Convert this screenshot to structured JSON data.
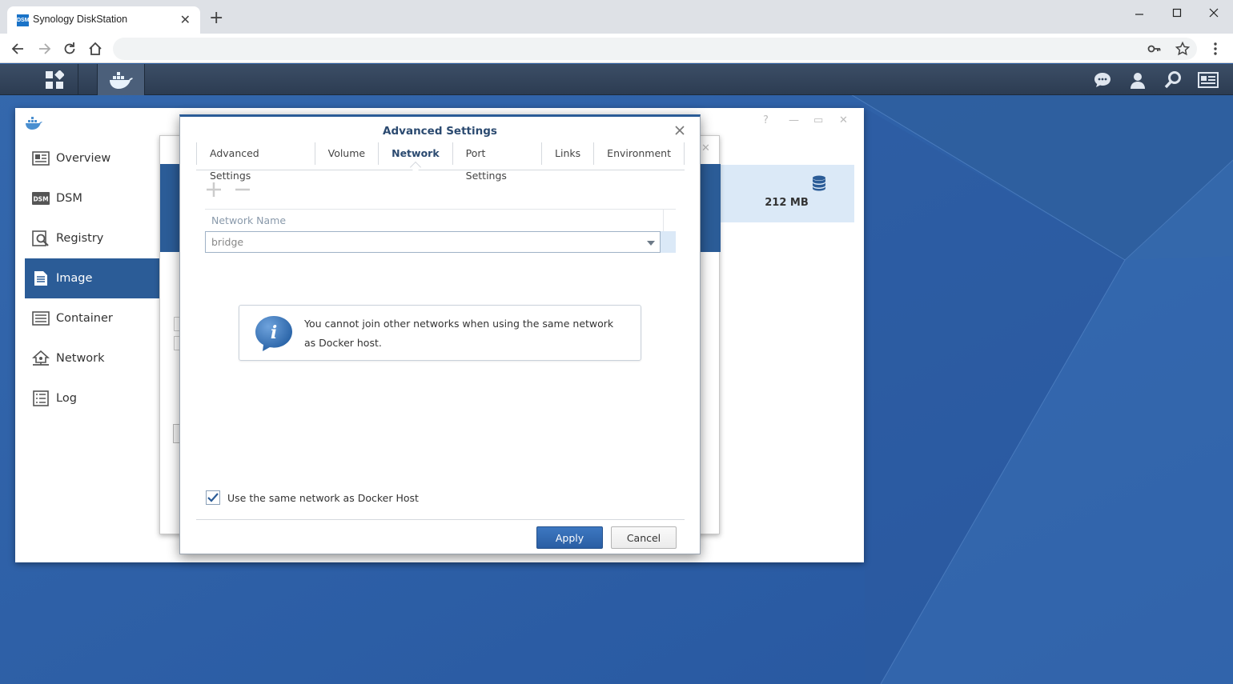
{
  "browser": {
    "tab_title": "Synology DiskStation",
    "favicon_text": "DSM",
    "address": ""
  },
  "sidebar": {
    "items": [
      {
        "label": "Overview",
        "icon": "overview-icon"
      },
      {
        "label": "DSM",
        "icon": "dsm-icon"
      },
      {
        "label": "Registry",
        "icon": "registry-icon"
      },
      {
        "label": "Image",
        "icon": "image-icon",
        "active": true
      },
      {
        "label": "Container",
        "icon": "container-icon"
      },
      {
        "label": "Network",
        "icon": "network-icon"
      },
      {
        "label": "Log",
        "icon": "log-icon"
      }
    ]
  },
  "image_panel": {
    "size": "212 MB"
  },
  "dialog": {
    "title": "Advanced Settings",
    "tabs": [
      "Advanced Settings",
      "Volume",
      "Network",
      "Port Settings",
      "Links",
      "Environment"
    ],
    "active_tab": "Network",
    "grid": {
      "column_header": "Network Name",
      "network_value": "bridge"
    },
    "info_message": "You cannot join other networks when using the same network as Docker host.",
    "checkbox_label": "Use the same network as Docker Host",
    "checkbox_checked": true,
    "apply_label": "Apply",
    "cancel_label": "Cancel"
  },
  "colors": {
    "accent": "#2b5c97",
    "desktop": "#2d5fa3",
    "selected_row": "#dbe9f7"
  }
}
